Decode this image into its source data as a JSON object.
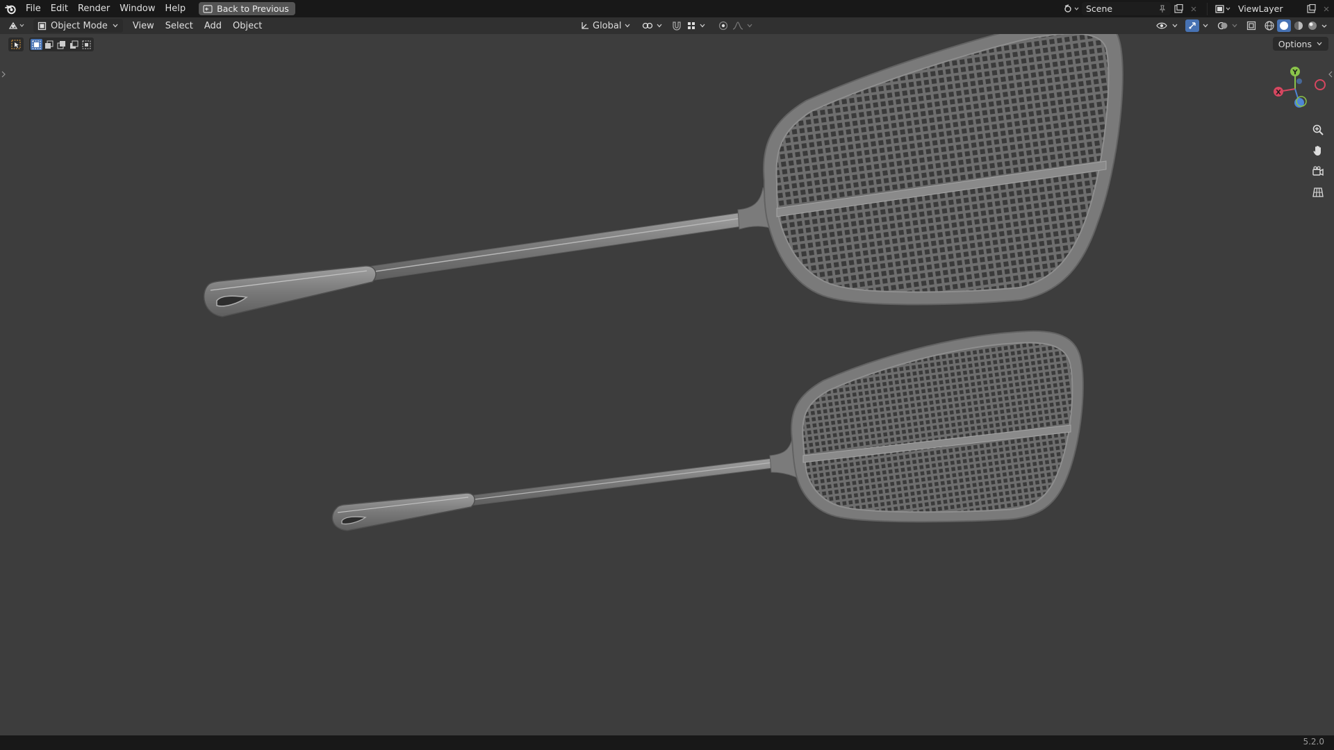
{
  "topbar": {
    "menus": [
      "File",
      "Edit",
      "Render",
      "Window",
      "Help"
    ],
    "back_label": "Back to Previous",
    "scene_name": "Scene",
    "view_layer": "ViewLayer"
  },
  "header": {
    "mode": "Object Mode",
    "menus": [
      "View",
      "Select",
      "Add",
      "Object"
    ],
    "transform_orientation": "Global",
    "options_label": "Options"
  },
  "gizmo": {
    "y_label": "Y",
    "x_label": "X"
  },
  "status": {
    "version": "5.2.0"
  },
  "colors": {
    "accent_blue": "#4772b3",
    "axis_x": "#d64760",
    "axis_y": "#8ac34a",
    "axis_z": "#4f86d6"
  }
}
